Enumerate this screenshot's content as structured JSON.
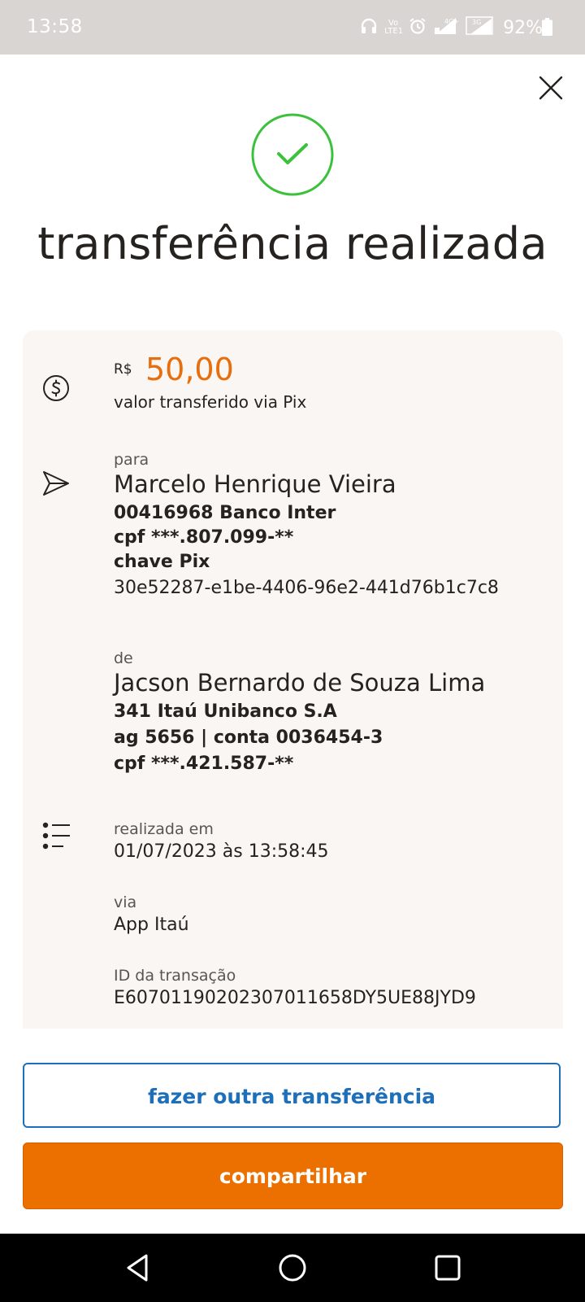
{
  "status_bar": {
    "time": "13:58",
    "battery": "92%",
    "network_1": "4G+",
    "network_2": "3G",
    "volte": "Vo LTE1"
  },
  "header": {
    "title": "transferência realizada",
    "close_icon": "close-icon",
    "success_icon": "check-circle-icon",
    "success_color": "#3cc13c"
  },
  "receipt": {
    "amount": {
      "currency": "R$",
      "value": "50,00",
      "label": "valor transferido via Pix"
    },
    "to": {
      "label": "para",
      "name": "Marcelo Henrique Vieira",
      "bank": "00416968 Banco Inter",
      "cpf": "cpf ***.807.099-**",
      "key_label": "chave Pix",
      "key": "30e52287-e1be-4406-96e2-441d76b1c7c8"
    },
    "from": {
      "label": "de",
      "name": "Jacson Bernardo de Souza Lima",
      "bank": "341 Itaú Unibanco S.A",
      "account": "ag 5656 | conta 0036454-3",
      "cpf": "cpf ***.421.587-**"
    },
    "details": {
      "date_label": "realizada em",
      "date": "01/07/2023 às 13:58:45",
      "via_label": "via",
      "via": "App Itaú",
      "id_label": "ID da transação",
      "id": "E60701190202307011658DY5UE88JYD9"
    }
  },
  "actions": {
    "another_transfer": "fazer outra transferência",
    "share": "compartilhar"
  },
  "colors": {
    "accent_orange": "#ec7000",
    "link_blue": "#1e6fba",
    "card_bg": "#f9f6f3"
  }
}
